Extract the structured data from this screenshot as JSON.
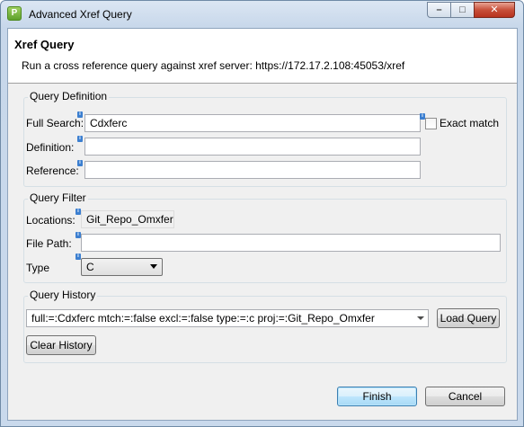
{
  "window": {
    "title": "Advanced Xref Query",
    "icon": "app-icon",
    "controls": {
      "minimize": "minimize-icon",
      "maximize": "maximize-icon",
      "close": "close-icon"
    }
  },
  "header": {
    "title": "Xref Query",
    "description": "Run a cross reference query against xref server: https://172.17.2.108:45053/xref"
  },
  "query_definition": {
    "label": "Query Definition",
    "full_search": {
      "label": "Full Search:",
      "value": "Cdxferc"
    },
    "exact_match": {
      "label": "Exact match",
      "checked": false
    },
    "definition": {
      "label": "Definition:",
      "value": ""
    },
    "reference": {
      "label": "Reference:",
      "value": ""
    }
  },
  "query_filter": {
    "label": "Query Filter",
    "locations": {
      "label": "Locations:",
      "value": "Git_Repo_Omxfer"
    },
    "file_path": {
      "label": "File Path:",
      "value": ""
    },
    "type": {
      "label": "Type",
      "value": "C"
    }
  },
  "query_history": {
    "label": "Query History",
    "selected": "full:=:Cdxferc mtch:=:false excl:=:false type:=:c  proj:=:Git_Repo_Omxfer",
    "load_button": "Load Query",
    "clear_button": "Clear History"
  },
  "footer": {
    "finish": "Finish",
    "cancel": "Cancel"
  },
  "info_marker": "i"
}
